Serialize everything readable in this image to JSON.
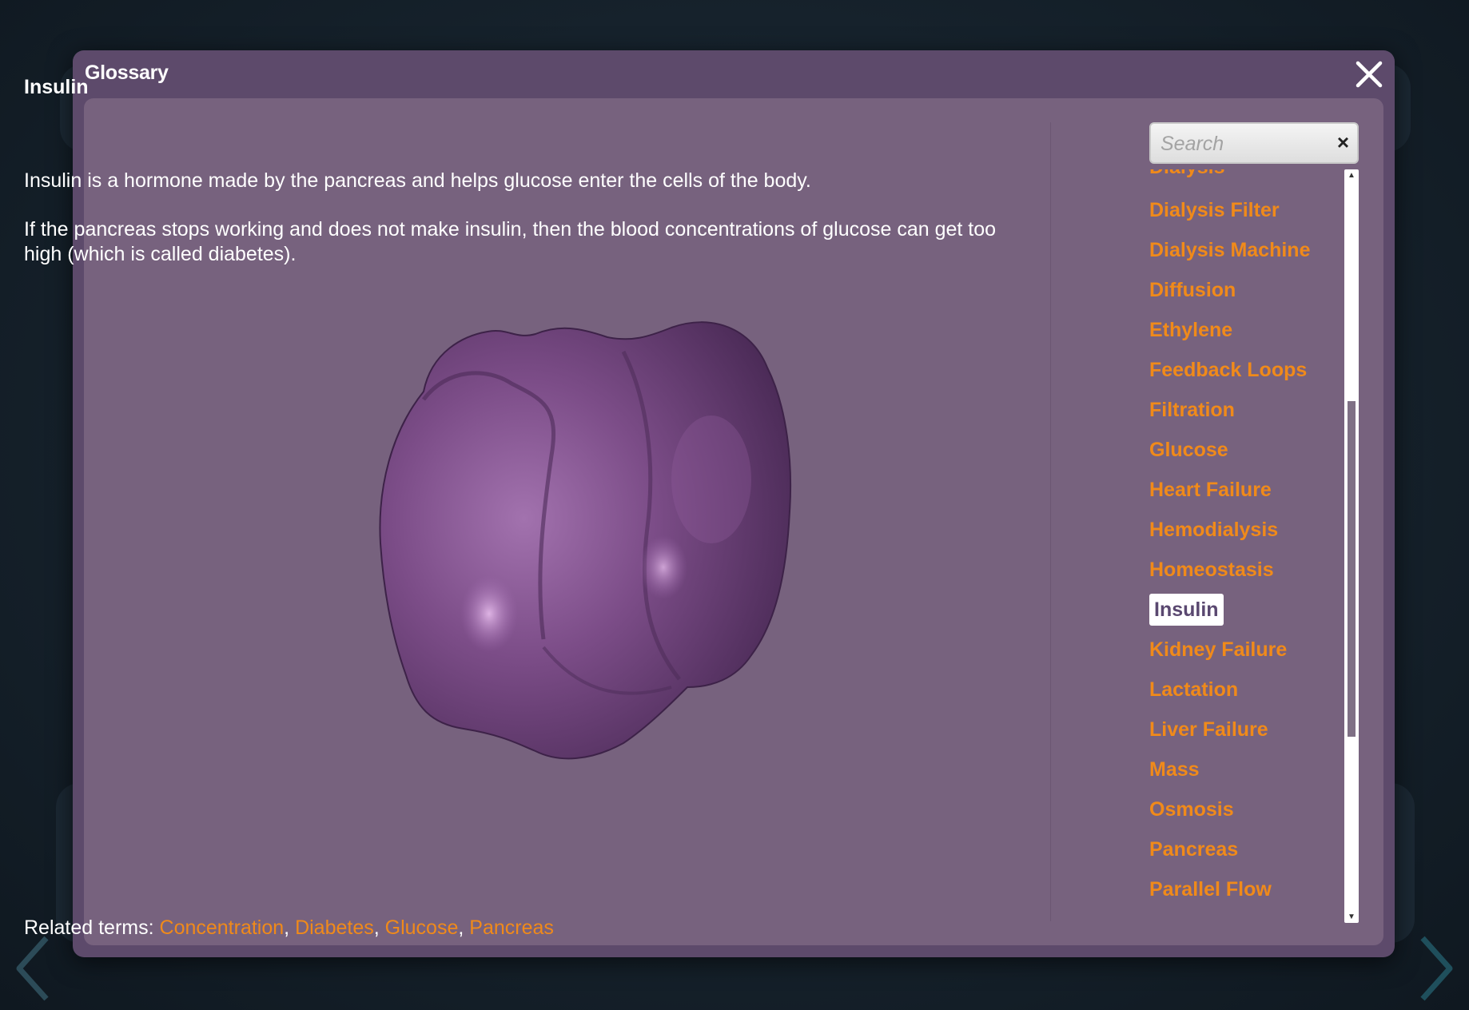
{
  "glossary": {
    "title": "Glossary",
    "term_title": "Insulin",
    "paragraphs": [
      "Insulin is a hormone made by the pancreas and helps glucose enter the cells of the body.",
      "If the pancreas stops working and does not make insulin, then the blood concentrations of glucose can get too high (which is called diabetes)."
    ],
    "related_label": "Related terms: ",
    "related_terms": [
      "Concentration",
      "Diabetes",
      "Glucose",
      "Pancreas"
    ],
    "search_placeholder": "Search",
    "search_clear": "×",
    "terms": [
      "Dialysis",
      "Dialysis Filter",
      "Dialysis Machine",
      "Diffusion",
      "Ethylene",
      "Feedback Loops",
      "Filtration",
      "Glucose",
      "Heart Failure",
      "Hemodialysis",
      "Homeostasis",
      "Insulin",
      "Kidney Failure",
      "Lactation",
      "Liver Failure",
      "Mass",
      "Osmosis",
      "Pancreas",
      "Parallel Flow"
    ],
    "selected_term": "Insulin"
  },
  "icons": {
    "close": "close-icon",
    "prev": "chevron-left-icon",
    "next": "chevron-right-icon",
    "scroll_up": "scroll-up-icon",
    "scroll_down": "scroll-down-icon"
  },
  "colors": {
    "link": "#f08a1a",
    "modal_frame": "#5d4a6b",
    "modal_content": "#77627e",
    "molecule": "#7a4d86"
  }
}
